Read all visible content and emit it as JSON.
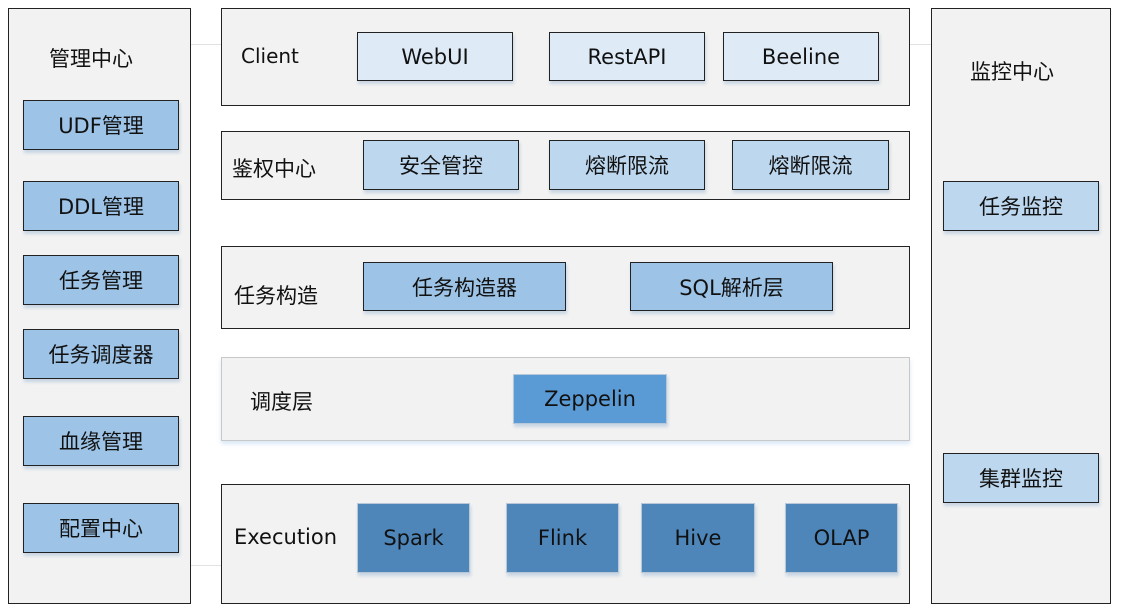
{
  "colors": {
    "client_item": "#deebf7",
    "auth_item": "#bdd7ee",
    "task_item": "#9dc3e6",
    "scheduler_item": "#5b9bd5",
    "execution_item": "#4e86ba",
    "panel_bg": "#f2f2f2"
  },
  "left": {
    "title": "管理中心",
    "items": [
      "UDF管理",
      "DDL管理",
      "任务管理",
      "任务调度器",
      "血缘管理",
      "配置中心"
    ]
  },
  "right": {
    "title": "监控中心",
    "items": [
      "任务监控",
      "集群监控"
    ]
  },
  "layers": {
    "client": {
      "label": "Client",
      "items": [
        "WebUI",
        "RestAPI",
        "Beeline"
      ]
    },
    "auth": {
      "label": "鉴权中心",
      "items": [
        "安全管控",
        "熔断限流",
        "熔断限流"
      ]
    },
    "task": {
      "label": "任务构造",
      "items": [
        "任务构造器",
        "SQL解析层"
      ]
    },
    "scheduler": {
      "label": "调度层",
      "items": [
        "Zeppelin"
      ]
    },
    "execution": {
      "label": "Execution",
      "items": [
        "Spark",
        "Flink",
        "Hive",
        "OLAP"
      ]
    }
  }
}
